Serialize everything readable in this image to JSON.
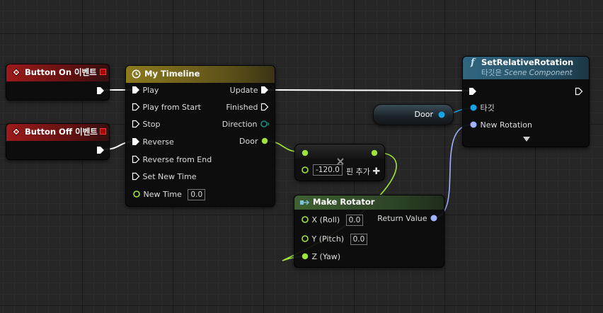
{
  "nodes": {
    "button_on": {
      "title": "Button On 이벤트"
    },
    "button_off": {
      "title": "Button Off 이벤트"
    },
    "timeline": {
      "title": "My Timeline",
      "inputs": [
        "Play",
        "Play from Start",
        "Stop",
        "Reverse",
        "Reverse from End",
        "Set New Time"
      ],
      "new_time_label": "New Time",
      "new_time_value": "0.0",
      "outputs": [
        "Update",
        "Finished",
        "Direction",
        "Door"
      ]
    },
    "add": {
      "value": "-120.0",
      "add_pin_label": "핀 추가"
    },
    "door_var": {
      "label": "Door"
    },
    "set_rotation": {
      "title": "SetRelativeRotation",
      "target_prefix": "타깃은",
      "target_class": "Scene Component",
      "target_pin": "타깃",
      "new_rotation": "New Rotation"
    },
    "make_rotator": {
      "title": "Make Rotator",
      "x_label": "X (Roll)",
      "x_value": "0.0",
      "y_label": "Y (Pitch)",
      "y_value": "0.0",
      "z_label": "Z (Yaw)",
      "return_label": "Return Value"
    }
  },
  "colors": {
    "exec": "#ffffff",
    "float": "#9ee53a",
    "object": "#1aa2e6",
    "rotator": "#9fb1ff",
    "struct": "#1b8a7d"
  }
}
